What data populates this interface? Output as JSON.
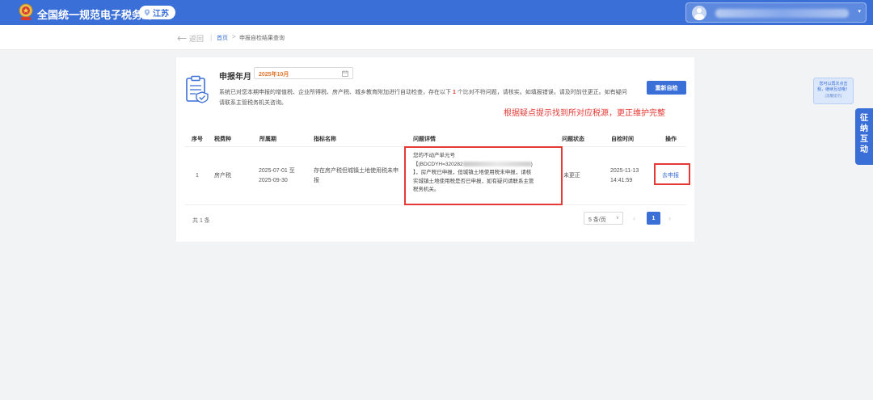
{
  "header": {
    "site_title": "全国统一规范电子税务局",
    "region": "江苏",
    "user_menu_caret": "▾"
  },
  "breadcrumb": {
    "back_label": "返回",
    "home_label": "首页",
    "separator": ">",
    "current_label": "申报自检结果查询"
  },
  "filter": {
    "period_label": "申报年月",
    "period_value": "2025年10月"
  },
  "notice": {
    "text_part1": "系统已对您本期申报的增值税、企业所得税、房产税、城乡教育附加进行自动检查，存在以下 ",
    "count": "1",
    "text_part2": " 个比对不符问题，请核实。如填报错误，请及时前往更正。如有疑问请联系主管税务机关咨询。"
  },
  "recheck_button_label": "重新自检",
  "annotation_text": "根据疑点提示找到所对应税源，更正维护完整",
  "table": {
    "headers": {
      "index": "序号",
      "tax_type": "税费种",
      "period": "所属期",
      "indicator": "指标名称",
      "detail": "问题详情",
      "status": "问题状态",
      "check_time": "自检时间",
      "action": "操作"
    },
    "rows": [
      {
        "index": "1",
        "tax_type": "房产税",
        "period_start": "2025-07-01 至",
        "period_end": "2025-09-30",
        "indicator_line1": "存在房产税但城镇土地使用税未申",
        "indicator_line2": "报",
        "detail_line1": "您的不动产单元号",
        "detail_line2": "【(BDCDYH=320282",
        "detail_line2_end": ")",
        "detail_line3": "】，房产税已申报，但城镇土地使用税未申报，请核",
        "detail_line4": "实城镇土地使用税是否已申报，如有疑问请联系主管",
        "detail_line5": "税务机关。",
        "status": "未更正",
        "check_date": "2025-11-13",
        "check_clock": "14:41:59",
        "action_label": "去申报"
      }
    ]
  },
  "pagination": {
    "total_label": "共 1 条",
    "page_size_label": "5 条/页",
    "page_size_caret": "∨",
    "prev": "‹",
    "current_page": "1",
    "next": "›"
  },
  "float_tip": {
    "line1": "您可以再次点击",
    "line2": "我，继续互动哦！",
    "line3": "(温馨提示)"
  },
  "side_tab": {
    "c1": "征",
    "c2": "纳",
    "c3": "互",
    "c4": "动"
  },
  "colors": {
    "primary": "#3a6fd8",
    "highlight_red": "#e53935",
    "period_orange": "#e0762d"
  }
}
